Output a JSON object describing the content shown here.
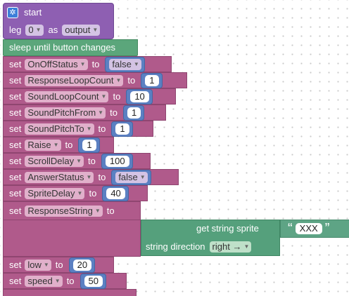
{
  "start_block": {
    "label": "start",
    "gear_glyph": "✲",
    "leg_label": "leg",
    "leg_value": "0",
    "as_label": "as",
    "mode_value": "output"
  },
  "sleep_block": {
    "label": "sleep until button changes"
  },
  "set_label": "set",
  "to_label": "to",
  "assignments": [
    {
      "var": "OnOffStatus",
      "value": "false"
    },
    {
      "var": "ResponseLoopCount",
      "value": "1"
    },
    {
      "var": "SoundLoopCount",
      "value": "10"
    },
    {
      "var": "SoundPitchFrom",
      "value": "1"
    },
    {
      "var": "SoundPitchTo",
      "value": "1"
    },
    {
      "var": "Raise",
      "value": "1"
    },
    {
      "var": "ScrollDelay",
      "value": "100"
    },
    {
      "var": "AnswerStatus",
      "value": "false"
    },
    {
      "var": "SpriteDelay",
      "value": "40"
    }
  ],
  "response_string": {
    "var": "ResponseString",
    "get_label": "get string sprite",
    "open_quote": "“",
    "text": "XXX",
    "close_quote": "”",
    "direction_label": "string direction",
    "direction_value": "right →"
  },
  "tail_assignments": [
    {
      "var": "low",
      "value": "20"
    },
    {
      "var": "speed",
      "value": "50"
    }
  ],
  "dropdown_arrow": "▼",
  "colors": {
    "purple": "#8e5fb2",
    "green": "#5ba67b",
    "mauve": "#b05a8b",
    "blue": "#5b80c2",
    "teal": "#55a07c"
  }
}
